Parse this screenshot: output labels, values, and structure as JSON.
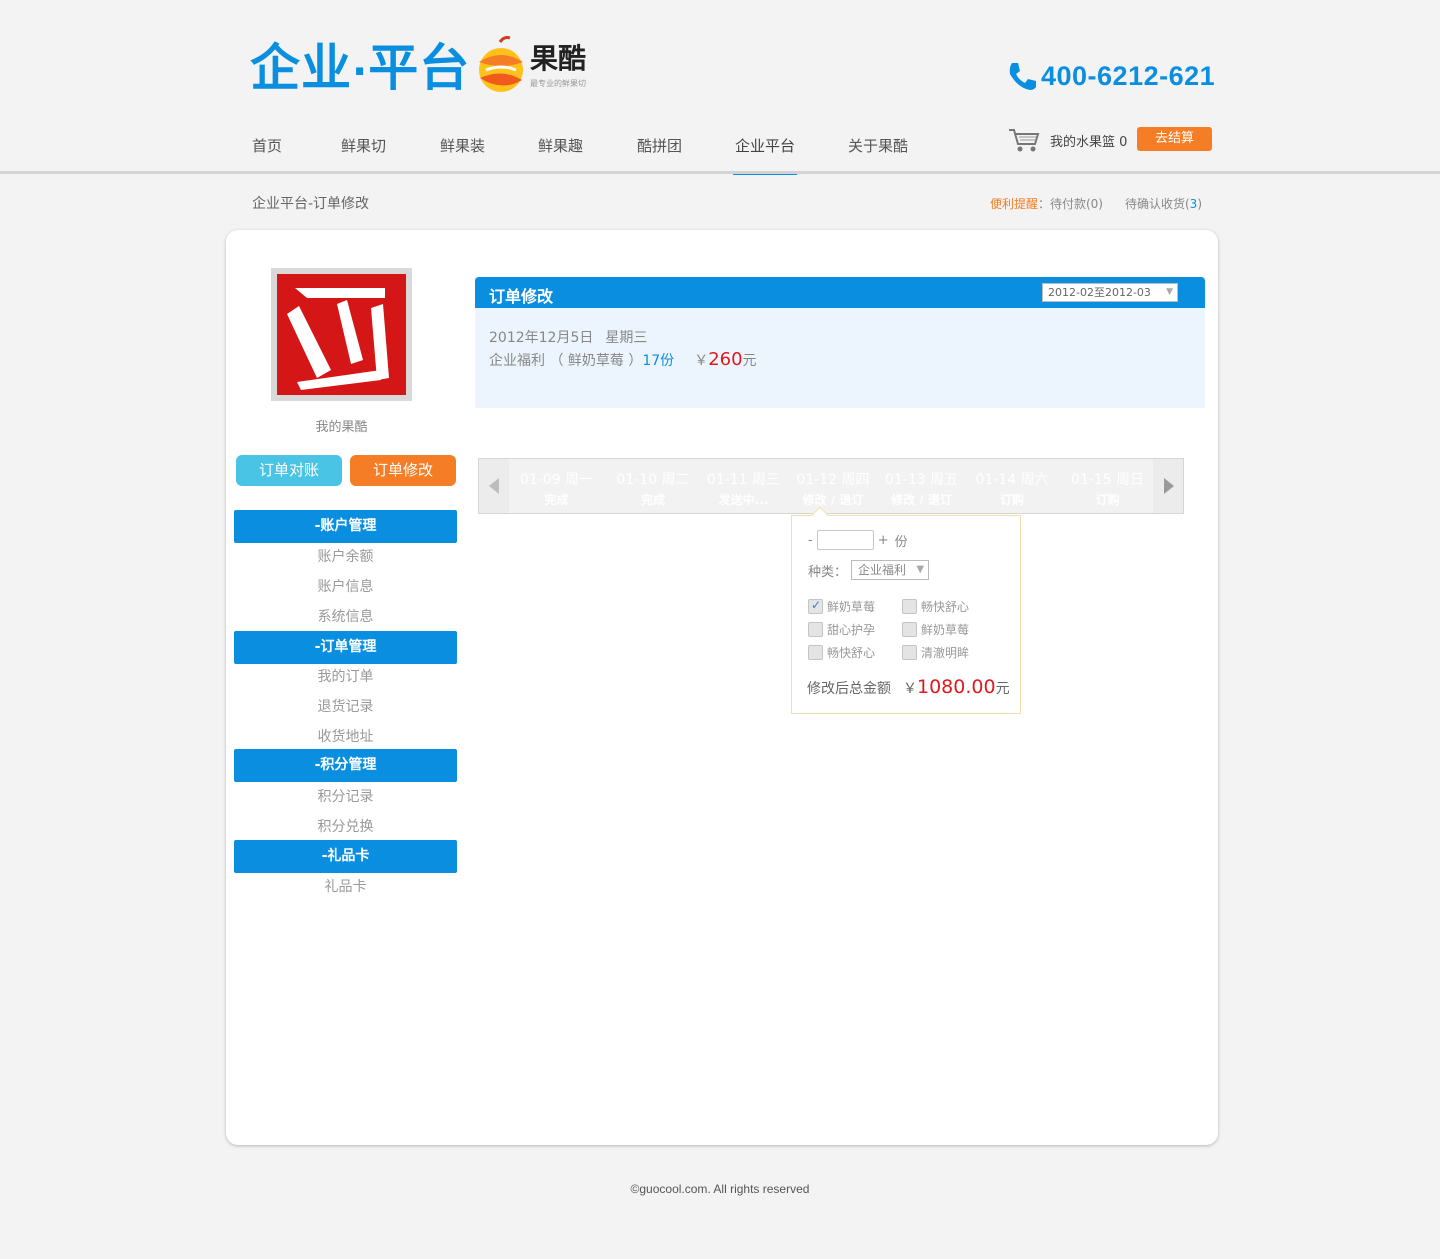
{
  "header": {
    "brand_main": "企业",
    "brand_dot": "·",
    "brand_sub": "平台",
    "logo_name": "果酷",
    "logo_slogan": "最专业的鲜果切",
    "phone": "400-6212-621"
  },
  "nav": {
    "items": [
      {
        "label": "首页"
      },
      {
        "label": "鲜果切"
      },
      {
        "label": "鲜果装"
      },
      {
        "label": "鲜果趣"
      },
      {
        "label": "酷拼团"
      },
      {
        "label": "企业平台",
        "active": true
      },
      {
        "label": "关于果酷"
      }
    ]
  },
  "cart": {
    "label": "我的水果篮 0",
    "checkout": "去结算"
  },
  "breadcrumb": "企业平台-订单修改",
  "reminder": {
    "label": "便利提醒",
    "pending_pay": "：待付款(0)",
    "pending_receive_prefix": "待确认收货(",
    "pending_receive_count": "3",
    "pending_receive_suffix": ")"
  },
  "sidebar": {
    "my_label": "我的果酷",
    "btn_reconcile": "订单对账",
    "btn_modify": "订单修改",
    "sections": [
      {
        "title": "-账户管理",
        "links": [
          "账户余额",
          "账户信息",
          "系统信息"
        ]
      },
      {
        "title": "-订单管理",
        "links": [
          "我的订单",
          "退货记录",
          "收货地址"
        ]
      },
      {
        "title": "-积分管理",
        "links": [
          "积分记录",
          "积分兑换"
        ]
      },
      {
        "title": "-礼品卡",
        "links": [
          "礼品卡"
        ]
      }
    ]
  },
  "order": {
    "title": "订单修改",
    "range": "2012-02至2012-03",
    "date": "2012年12月5日",
    "weekday": "星期三",
    "item": "企业福利 （ 鲜奶草莓 ）",
    "qty": "17份",
    "currency": "￥",
    "price": "260",
    "unit": "元"
  },
  "days": [
    {
      "date": "01-09 周一",
      "status": "完成",
      "color": "#0a8fe0"
    },
    {
      "date": "01-10 周二",
      "status": "完成",
      "color": "#0a8fe0"
    },
    {
      "date": "01-11 周三",
      "status": "发送中...",
      "color": "#e01010"
    },
    {
      "date": "01-12 周四",
      "status": "修改 / 退订",
      "color": "#fea400"
    },
    {
      "date": "01-13 周五",
      "status": "修改 / 退订",
      "color": "#fea400"
    },
    {
      "date": "01-14 周六",
      "status": "订购",
      "color": "#c9c9c9"
    },
    {
      "date": "01-15 周日",
      "status": "订购",
      "color": "#c9c9c9"
    }
  ],
  "popover": {
    "minus": "-",
    "plus": "+",
    "unit": "份",
    "kind_label": "种类：",
    "kind_value": "企业福利",
    "options": [
      {
        "label": "鲜奶草莓",
        "checked": true
      },
      {
        "label": "畅快舒心",
        "checked": false
      },
      {
        "label": "甜心护孕",
        "checked": false
      },
      {
        "label": "鲜奶草莓",
        "checked": false
      },
      {
        "label": "畅快舒心",
        "checked": false
      },
      {
        "label": "清澈明眸",
        "checked": false
      }
    ],
    "total_label": "修改后总金额",
    "currency": "￥",
    "total": "1080.00",
    "total_unit": "元"
  },
  "footer": "©guocool.com. All rights reserved"
}
